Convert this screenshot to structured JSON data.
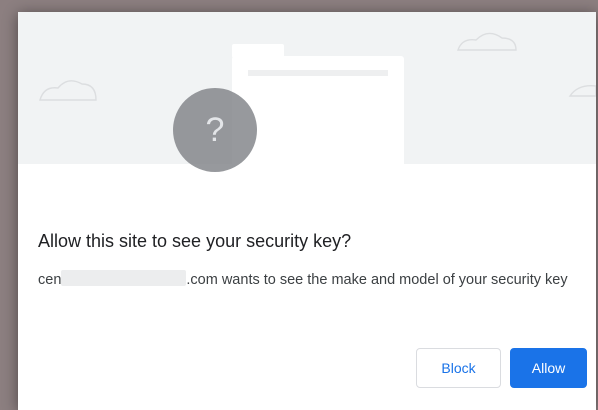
{
  "dialog": {
    "title": "Allow this site to see your security key?",
    "message_start": "cen",
    "message_rest": ".com wants to see the make and model of your security key",
    "illustration_icon": "question-mark-icon",
    "question_mark": "?"
  },
  "buttons": {
    "block_label": "Block",
    "allow_label": "Allow"
  },
  "colors": {
    "primary": "#1a73e8",
    "illustration_bg": "#f1f3f4",
    "backdrop": "#8c7f80"
  }
}
